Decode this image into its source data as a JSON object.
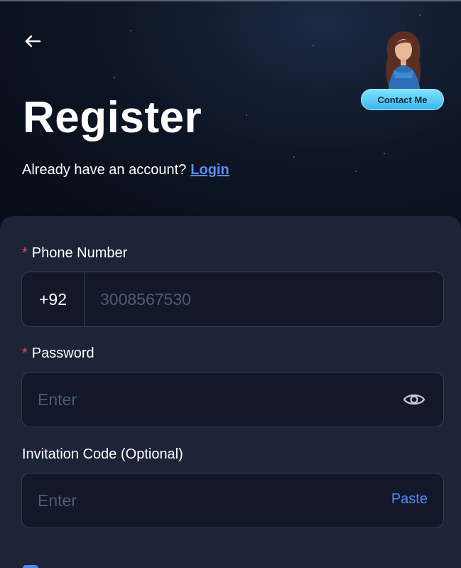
{
  "header": {
    "back_icon": "arrow-left-icon",
    "title": "Register",
    "subtitle": "Already have an account?",
    "login_link": "Login",
    "contact_button": "Contact Me",
    "link_color": "#5b8cff"
  },
  "form": {
    "phone": {
      "label": "Phone Number",
      "required_mark": "*",
      "country_code": "+92",
      "placeholder": "3008567530"
    },
    "password": {
      "label": "Password",
      "required_mark": "*",
      "placeholder": "Enter",
      "toggle_icon": "eye-icon"
    },
    "invitation": {
      "label": "Invitation Code (Optional)",
      "placeholder": "Enter",
      "paste_label": "Paste"
    }
  },
  "colors": {
    "accent": "#4f86ff",
    "required": "#e5484d",
    "panel": "#1d2438",
    "field": "#121829"
  }
}
